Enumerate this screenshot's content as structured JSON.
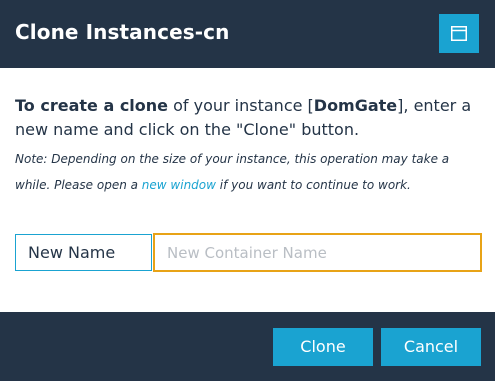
{
  "dialog": {
    "title": "Clone Instances-cn",
    "window_icon": "window-icon"
  },
  "message": {
    "bold_intro": "To create a clone",
    "text_1": " of your instance [",
    "instance_name": "DomGate",
    "text_2": "], enter a new name and click on the \"Clone\" button."
  },
  "note": {
    "text_1": "Note: Depending on the size of your instance, this operation may take a while. Please open a ",
    "link": "new window",
    "text_2": " if you want to continue to work."
  },
  "form": {
    "label": "New Name",
    "placeholder": "New Container Name",
    "value": ""
  },
  "footer": {
    "clone_label": "Clone",
    "cancel_label": "Cancel"
  },
  "colors": {
    "header_bg": "#243447",
    "accent": "#1aa3d1",
    "focus_border": "#e8a317"
  }
}
